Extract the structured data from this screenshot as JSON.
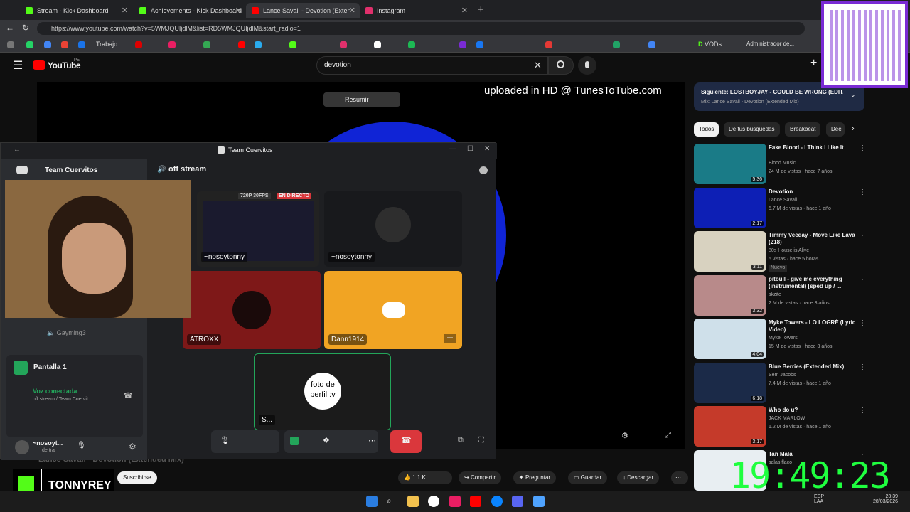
{
  "tabs": [
    {
      "label": "Stream - Kick Dashboard",
      "color": "#53fc18"
    },
    {
      "label": "Achievements - Kick Dashboard",
      "color": "#53fc18"
    },
    {
      "label": "Lance Savali - Devotion (Exten",
      "color": "#ff0000"
    },
    {
      "label": "Instagram",
      "color": "#e1306c"
    }
  ],
  "url": "https://www.youtube.com/watch?v=5WMJQUIjdlM&list=RD5WMJQUIjdlM&start_radio=1",
  "bookmarks": {
    "folder": "Trabajo",
    "vods": "VODs",
    "admin": "Administrador de..."
  },
  "youtube": {
    "logo": "YouTube",
    "region": "PE",
    "search_value": "devotion"
  },
  "player": {
    "overlay_text": "uploaded in HD @ TunesToTube.com",
    "summarize": "Resumir",
    "title_below": "Lance Savali - Devotion (Extended Mix)",
    "subscribe": "Suscribirse",
    "likes": "1.1 K",
    "share": "Compartir",
    "ask": "Preguntar",
    "save": "Guardar",
    "download": "Descargar"
  },
  "upnext": {
    "title": "Siguiente: LOSTBOYJAY - COULD BE WRONG (EDIT...",
    "mix": "Mix: Lance Savali - Devotion (Extended Mix)"
  },
  "chips": [
    "Todos",
    "De tus búsquedas",
    "Breakbeat",
    "Dee"
  ],
  "recs": [
    {
      "title": "Fake Blood - I Think I Like It",
      "channel": "Blood Music",
      "meta": "24 M de vistas · hace 7 años",
      "dur": "5:36",
      "color": "#1a7b87"
    },
    {
      "title": "Devotion",
      "channel": "Lance Savali",
      "meta": "5.7 M de vistas · hace 1 año",
      "dur": "2:17",
      "color": "#0d1fb5"
    },
    {
      "title": "Timmy Veeday - Move Like Lava (218)",
      "channel": "80s House is Alive",
      "meta": "5 vistas · hace 5 horas",
      "badge": "Nuevo",
      "dur": "3:11",
      "color": "#d8d2c0"
    },
    {
      "title": "pitbull - give me everything (instrumental) [sped up / ...",
      "channel": "skzite",
      "meta": "2 M de vistas · hace 3 años",
      "dur": "3:32",
      "color": "#b88a8a"
    },
    {
      "title": "Myke Towers - LO LOGRÉ (Lyric Video)",
      "channel": "Myke Towers",
      "meta": "15 M de vistas · hace 3 años",
      "dur": "4:04",
      "color": "#cfe0ea"
    },
    {
      "title": "Blue Berries (Extended Mix)",
      "channel": "Sem Jacobs",
      "meta": "7.4 M de vistas · hace 1 año",
      "dur": "6:18",
      "color": "#1b2a48"
    },
    {
      "title": "Who do u?",
      "channel": "JACK MARLOW",
      "meta": "1.2 M de vistas · hace 1 año",
      "dur": "3:17",
      "color": "#c53a2a"
    },
    {
      "title": "Tan Mala",
      "channel": "salas flaco",
      "meta": "",
      "dur": "",
      "color": "#e8eef2"
    }
  ],
  "discord": {
    "window_title": "Team Cuervitos",
    "server": "Team Cuervitos",
    "channel": "off stream",
    "voice_channel": "Gayming3",
    "screen": "Pantalla 1",
    "voice_status": "Voz conectada",
    "voice_sub": "off stream / Team Cuervit...",
    "user": "~nosoyt...",
    "user_sub": "de tra",
    "tiles": [
      {
        "name": "~nosoytonny",
        "badge1": "720P 30FPS",
        "badge2": "EN DIRECTO"
      },
      {
        "name": "~nosoytonny"
      },
      {
        "name": "ATROXX"
      },
      {
        "name": "Dann1914"
      },
      {
        "name": "S...",
        "avatar_text": "foto de perfil :v"
      }
    ]
  },
  "stream": {
    "brand": "TONNYREY",
    "clock": "19:49:23"
  },
  "taskbar": {
    "lang1": "ESP",
    "lang2": "LAA",
    "time": "23:39",
    "date": "28/03/2026"
  }
}
